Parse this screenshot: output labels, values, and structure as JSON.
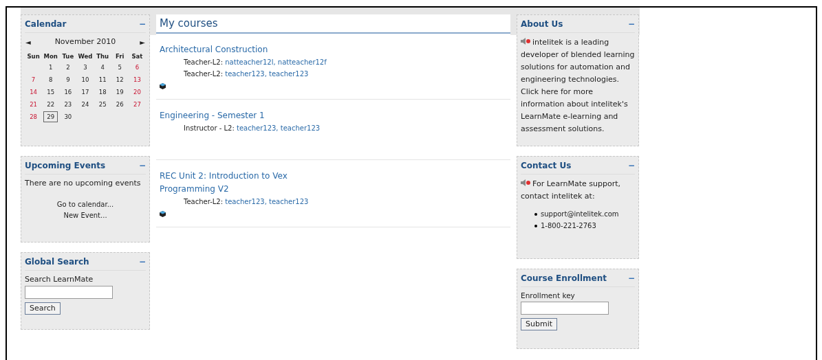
{
  "calendar": {
    "title": "Calendar",
    "collapse": "−",
    "prev": "◄",
    "next": "►",
    "month": "November 2010",
    "weekdays": [
      "Sun",
      "Mon",
      "Tue",
      "Wed",
      "Thu",
      "Fri",
      "Sat"
    ],
    "weeks": [
      [
        {
          "d": "1",
          "today": false
        },
        {
          "d": "2",
          "today": false
        },
        {
          "d": "3",
          "today": false
        },
        {
          "d": "4",
          "today": false
        },
        {
          "d": "5",
          "today": false
        },
        {
          "d": "6",
          "today": false
        }
      ],
      [
        {
          "d": "7",
          "today": false
        },
        {
          "d": "8",
          "today": false
        },
        {
          "d": "9",
          "today": false
        },
        {
          "d": "10",
          "today": false
        },
        {
          "d": "11",
          "today": false
        },
        {
          "d": "12",
          "today": false
        },
        {
          "d": "13",
          "today": false
        }
      ],
      [
        {
          "d": "14",
          "today": false
        },
        {
          "d": "15",
          "today": false
        },
        {
          "d": "16",
          "today": false
        },
        {
          "d": "17",
          "today": false
        },
        {
          "d": "18",
          "today": false
        },
        {
          "d": "19",
          "today": false
        },
        {
          "d": "20",
          "today": false
        }
      ],
      [
        {
          "d": "21",
          "today": false
        },
        {
          "d": "22",
          "today": false
        },
        {
          "d": "23",
          "today": false
        },
        {
          "d": "24",
          "today": false
        },
        {
          "d": "25",
          "today": false
        },
        {
          "d": "26",
          "today": false
        },
        {
          "d": "27",
          "today": false
        }
      ],
      [
        {
          "d": "28",
          "today": false
        },
        {
          "d": "29",
          "today": true
        },
        {
          "d": "30",
          "today": false
        }
      ]
    ]
  },
  "upcoming_events": {
    "title": "Upcoming Events",
    "collapse": "−",
    "message": "There are no upcoming events",
    "links": [
      "Go to calendar...",
      "New Event..."
    ]
  },
  "global_search": {
    "title": "Global Search",
    "collapse": "−",
    "label": "Search LearnMate",
    "button": "Search"
  },
  "my_courses": {
    "title": "My courses",
    "courses": [
      {
        "name": "Architectural Construction",
        "teachers": [
          {
            "role": "Teacher-L2:",
            "names": [
              "natteacher12l,",
              "natteacher12f"
            ]
          },
          {
            "role": "Teacher-L2:",
            "names": [
              "teacher123,",
              "teacher123"
            ]
          }
        ],
        "icon": true
      },
      {
        "name": "Engineering - Semester 1",
        "teachers": [
          {
            "role": "Instructor - L2:",
            "names": [
              "teacher123,",
              "teacher123"
            ]
          }
        ],
        "icon": false
      },
      {
        "name": "REC Unit 2: Introduction to Vex Programming V2",
        "teachers": [
          {
            "role": "Teacher-L2:",
            "names": [
              "teacher123,",
              "teacher123"
            ]
          }
        ],
        "icon": true
      }
    ]
  },
  "about_us": {
    "title": "About Us",
    "collapse": "−",
    "text": "intelitek is a leading developer of blended learning solutions for automation and engineering technologies. Click here for more information about intelitek's LearnMate e-learning and assessment solutions."
  },
  "contact_us": {
    "title": "Contact Us",
    "collapse": "−",
    "text": "For LearnMate support, contact intelitek at:",
    "items": [
      "support@intelitek.com",
      "1-800-221-2763"
    ]
  },
  "course_enrollment": {
    "title": "Course Enrollment",
    "collapse": "−",
    "label": "Enrollment key",
    "button": "Submit"
  }
}
